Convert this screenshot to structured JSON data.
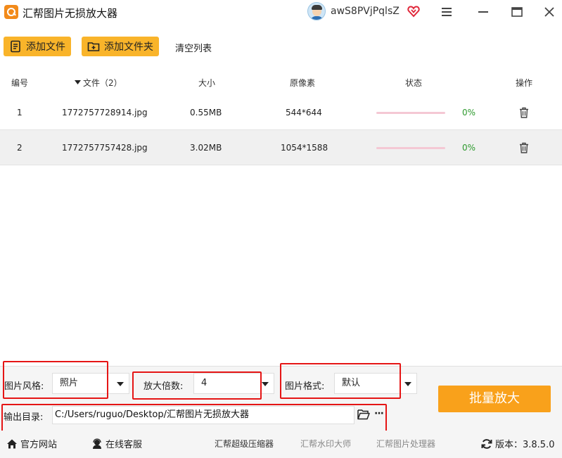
{
  "window": {
    "title": "汇帮图片无损放大器",
    "username": "awS8PVjPqlsZ"
  },
  "toolbar": {
    "add_file": "添加文件",
    "add_folder": "添加文件夹",
    "clear_list": "清空列表"
  },
  "table": {
    "headers": {
      "index": "编号",
      "file": "文件（2）",
      "size": "大小",
      "pixels": "原像素",
      "status": "状态",
      "action": "操作"
    },
    "rows": [
      {
        "index": "1",
        "file": "1772757728914.jpg",
        "size": "0.55MB",
        "pixels": "544*644",
        "progress": 0,
        "percent": "0%"
      },
      {
        "index": "2",
        "file": "1772757757428.jpg",
        "size": "3.02MB",
        "pixels": "1054*1588",
        "progress": 0,
        "percent": "0%"
      }
    ]
  },
  "settings": {
    "style_label": "图片风格:",
    "style_value": "照片",
    "scale_label": "放大倍数:",
    "scale_value": "4",
    "format_label": "图片格式:",
    "format_value": "默认",
    "output_label": "输出目录:",
    "output_path": "C:/Users/ruguo/Desktop/汇帮图片无损放大器",
    "more": "···",
    "batch_button": "批量放大"
  },
  "statusbar": {
    "official_site": "官方网站",
    "online_service": "在线客服",
    "link_compress": "汇帮超级压缩器",
    "link_watermark": "汇帮水印大师",
    "link_processor": "汇帮图片处理器",
    "version": "版本：3.8.5.0"
  },
  "colors": {
    "accent": "#f9b42a",
    "batch": "#f9a11b",
    "highlight_box": "#e51515",
    "progress_track": "#f4c8d4",
    "percent_text": "#2e9a2e"
  },
  "icons": {
    "logo": "app-logo-icon",
    "vip": "heart-vip-icon",
    "menu": "hamburger-menu-icon",
    "minimize": "minimize-icon",
    "maximize": "maximize-icon",
    "close": "close-icon",
    "add_file": "document-list-icon",
    "add_folder": "folder-plus-icon",
    "delete": "trash-icon",
    "browse": "folder-open-icon",
    "home": "home-icon",
    "service": "headset-icon",
    "refresh": "refresh-icon",
    "sort": "sort-down-icon"
  }
}
